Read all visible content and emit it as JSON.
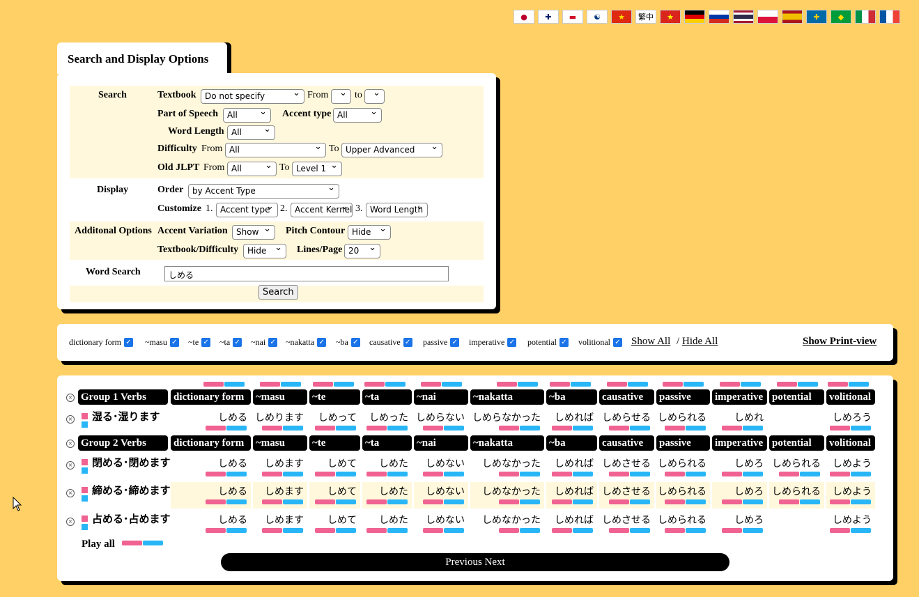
{
  "flags": [
    {
      "name": "flag-japan",
      "text": "●",
      "color": "#bc002d"
    },
    {
      "name": "flag-uk",
      "text": "✚",
      "color": "#012169"
    },
    {
      "name": "flag-indonesia",
      "text": "▬",
      "color": "#ce1126"
    },
    {
      "name": "flag-korea",
      "text": "☯",
      "color": "#003478"
    },
    {
      "name": "flag-china",
      "text": "★",
      "color": "#ffde00"
    },
    {
      "name": "flag-traditional-chinese",
      "text": "繁中",
      "color": "#000000"
    },
    {
      "name": "flag-vietnam",
      "text": "★",
      "color": "#ffff00"
    },
    {
      "name": "flag-germany",
      "text": "",
      "color": "#000000"
    },
    {
      "name": "flag-russia",
      "text": "",
      "color": "#0039a6"
    },
    {
      "name": "flag-thailand",
      "text": "",
      "color": "#2d2a4a"
    },
    {
      "name": "flag-poland",
      "text": "",
      "color": "#dc143c"
    },
    {
      "name": "flag-spain",
      "text": "",
      "color": "#aa151b"
    },
    {
      "name": "flag-sweden",
      "text": "✚",
      "color": "#fecc00"
    },
    {
      "name": "flag-brazil",
      "text": "◆",
      "color": "#ffdf00"
    },
    {
      "name": "flag-italy",
      "text": "",
      "color": "#009246"
    },
    {
      "name": "flag-france",
      "text": "",
      "color": "#0055a4"
    }
  ],
  "options": {
    "tab_title": "Search and Display Options",
    "search_label": "Search",
    "textbook_label": "Textbook",
    "textbook_value": "Do not specify",
    "from_label": "From",
    "to_label": "to",
    "from_value": "",
    "to_value": "",
    "pos_label": "Part of Speech",
    "pos_value": "All",
    "accent_type_label": "Accent type",
    "accent_type_value": "All",
    "word_length_label": "Word Length",
    "word_length_value": "All",
    "difficulty_label": "Difficulty",
    "difficulty_from_label": "From",
    "difficulty_from_value": "All",
    "difficulty_to_label": "To",
    "difficulty_to_value": "Upper Advanced",
    "jlpt_label": "Old JLPT",
    "jlpt_from_label": "From",
    "jlpt_from_value": "All",
    "jlpt_to_label": "To",
    "jlpt_to_value": "Level 1",
    "display_label": "Display",
    "order_label": "Order",
    "order_value": "by Accent Type",
    "customize_label": "Customize",
    "c1": "1.",
    "c1_value": "Accent type",
    "c2": "2.",
    "c2_value": "Accent Kernel",
    "c3": "3.",
    "c3_value": "Word Length",
    "additional_label": "Additonal Options",
    "accent_variation_label": "Accent Variation",
    "accent_variation_value": "Show",
    "pitch_contour_label": "Pitch Contour",
    "pitch_contour_value": "Hide",
    "textbook_difficulty_label": "Textbook/Difficulty",
    "textbook_difficulty_value": "Hide",
    "lines_page_label": "Lines/Page",
    "lines_page_value": "20",
    "word_search_label": "Word Search",
    "word_search_value": "しめる",
    "search_button": "Search"
  },
  "columns": [
    "dictionary form",
    "~masu",
    "~te",
    "~ta",
    "~nai",
    "~nakatta",
    "~ba",
    "causative",
    "passive",
    "imperative",
    "potential",
    "volitional"
  ],
  "checks": {
    "show_all": "Show All",
    "sep": "/",
    "hide_all": "Hide All",
    "print_view": "Show Print-view"
  },
  "results": {
    "group1": "Group 1 Verbs",
    "group2": "Group 2 Verbs",
    "rows": [
      {
        "word": "湿る･湿ります",
        "forms": [
          "しめる",
          "しめります",
          "しめって",
          "しめった",
          "しめらない",
          "しめらなかった",
          "しめれば",
          "しめらせる",
          "しめられる",
          "しめれ",
          "",
          "しめろう"
        ]
      },
      {
        "word": "閉める･閉めます",
        "forms": [
          "しめる",
          "しめます",
          "しめて",
          "しめた",
          "しめない",
          "しめなかった",
          "しめれば",
          "しめさせる",
          "しめられる",
          "しめろ",
          "しめられる",
          "しめよう"
        ]
      },
      {
        "word": "締める･締めます",
        "forms": [
          "しめる",
          "しめます",
          "しめて",
          "しめた",
          "しめない",
          "しめなかった",
          "しめれば",
          "しめさせる",
          "しめられる",
          "しめろ",
          "しめられる",
          "しめよう"
        ]
      },
      {
        "word": "占める･占めます",
        "forms": [
          "しめる",
          "しめます",
          "しめて",
          "しめた",
          "しめない",
          "しめなかった",
          "しめれば",
          "しめさせる",
          "しめられる",
          "しめろ",
          "",
          "しめよう"
        ]
      }
    ],
    "play_all": "Play all",
    "pager": "Previous Next"
  }
}
